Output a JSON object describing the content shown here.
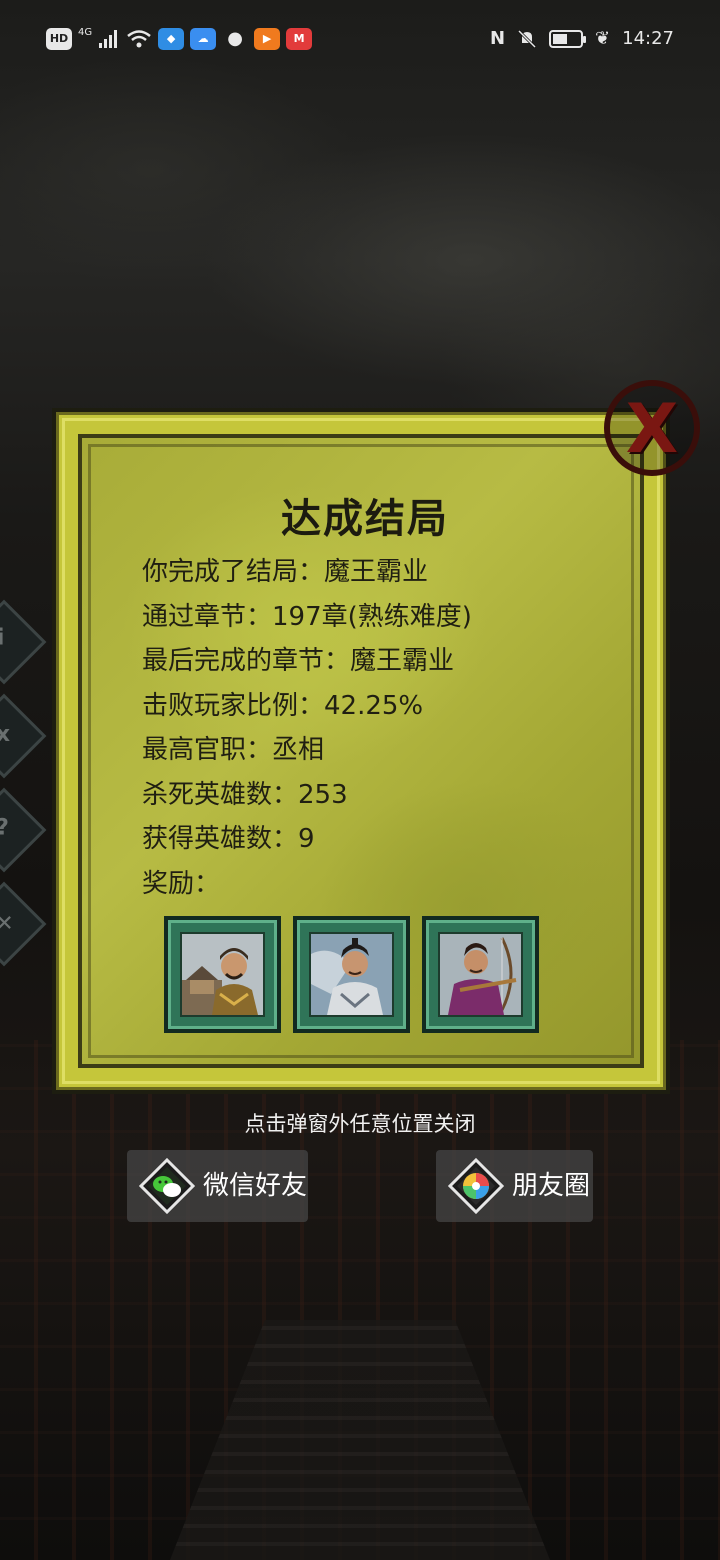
{
  "status_bar": {
    "hd_label": "HD",
    "network_label": "4G",
    "time": "14:27"
  },
  "dialog": {
    "title": "达成结局",
    "rows": [
      "你完成了结局：魔王霸业",
      "通过章节：197章(熟练难度)",
      "最后完成的章节：魔王霸业",
      "击败玩家比例：42.25%",
      "最高官职：丞相",
      "杀死英雄数：253",
      "获得英雄数：9",
      "奖励："
    ],
    "close_label": "X"
  },
  "hint": "点击弹窗外任意位置关闭",
  "share": {
    "wechat_label": "微信好友",
    "moments_label": "朋友圈"
  },
  "colors": {
    "parchment": "#c5c63a",
    "reward_frame": "#2f7458",
    "close_red": "#7a1712"
  }
}
